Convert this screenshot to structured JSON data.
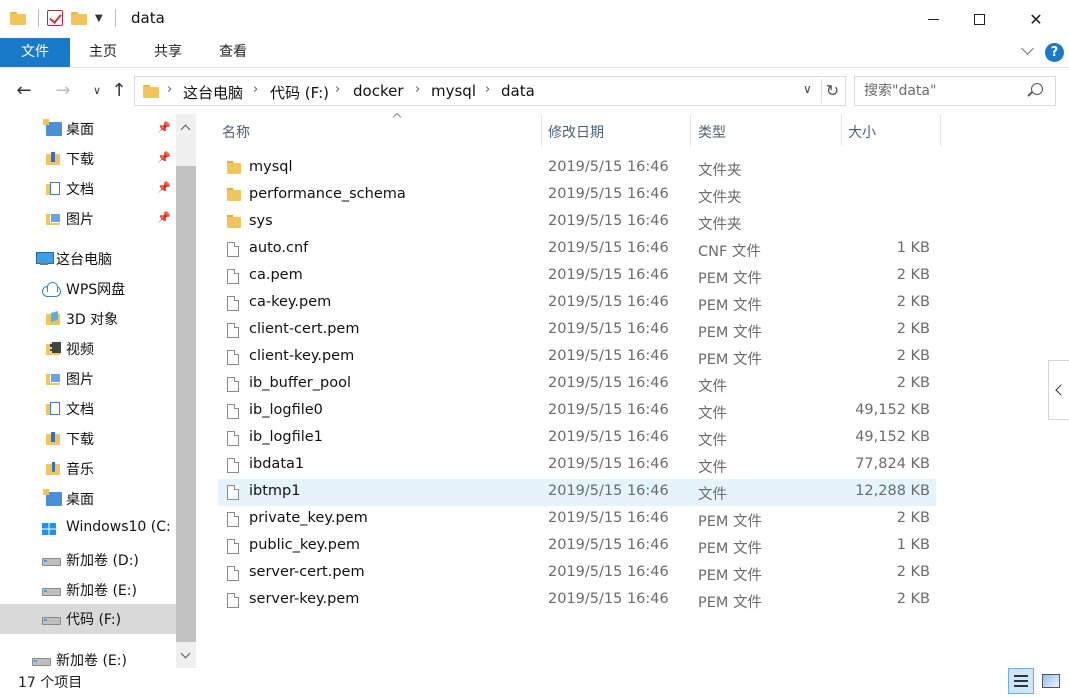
{
  "window": {
    "title": "data"
  },
  "ribbon": {
    "tabs": [
      "文件",
      "主页",
      "共享",
      "查看"
    ]
  },
  "address": {
    "crumbs": [
      "这台电脑",
      "代码 (F:)",
      "docker",
      "mysql",
      "data"
    ],
    "search_placeholder": "搜索\"data\""
  },
  "nav_pane": {
    "items": [
      {
        "label": "桌面",
        "icon": "desktop-icon",
        "pinned": true
      },
      {
        "label": "下载",
        "icon": "downloads-icon",
        "pinned": true
      },
      {
        "label": "文档",
        "icon": "documents-icon",
        "pinned": true
      },
      {
        "label": "图片",
        "icon": "pictures-icon",
        "pinned": true
      },
      {
        "label": "这台电脑",
        "icon": "this-pc-icon"
      },
      {
        "label": "WPS网盘",
        "icon": "wps-cloud-icon"
      },
      {
        "label": "3D 对象",
        "icon": "3d-objects-icon"
      },
      {
        "label": "视频",
        "icon": "videos-icon"
      },
      {
        "label": "图片",
        "icon": "pictures-icon"
      },
      {
        "label": "文档",
        "icon": "documents-icon"
      },
      {
        "label": "下载",
        "icon": "downloads-icon"
      },
      {
        "label": "音乐",
        "icon": "music-icon"
      },
      {
        "label": "桌面",
        "icon": "desktop-icon"
      },
      {
        "label": "Windows10 (C:",
        "icon": "windows-drive-icon"
      },
      {
        "label": "新加卷 (D:)",
        "icon": "drive-icon"
      },
      {
        "label": "新加卷 (E:)",
        "icon": "drive-icon"
      },
      {
        "label": "代码 (F:)",
        "icon": "drive-icon",
        "selected": true
      },
      {
        "label": "新加卷 (E:)",
        "icon": "drive-icon"
      }
    ]
  },
  "columns": {
    "name": "名称",
    "date": "修改日期",
    "type": "类型",
    "size": "大小"
  },
  "files": [
    {
      "name": "mysql",
      "date": "2019/5/15 16:46",
      "type": "文件夹",
      "size": "",
      "kind": "folder"
    },
    {
      "name": "performance_schema",
      "date": "2019/5/15 16:46",
      "type": "文件夹",
      "size": "",
      "kind": "folder"
    },
    {
      "name": "sys",
      "date": "2019/5/15 16:46",
      "type": "文件夹",
      "size": "",
      "kind": "folder"
    },
    {
      "name": "auto.cnf",
      "date": "2019/5/15 16:46",
      "type": "CNF 文件",
      "size": "1 KB",
      "kind": "file"
    },
    {
      "name": "ca.pem",
      "date": "2019/5/15 16:46",
      "type": "PEM 文件",
      "size": "2 KB",
      "kind": "file"
    },
    {
      "name": "ca-key.pem",
      "date": "2019/5/15 16:46",
      "type": "PEM 文件",
      "size": "2 KB",
      "kind": "file"
    },
    {
      "name": "client-cert.pem",
      "date": "2019/5/15 16:46",
      "type": "PEM 文件",
      "size": "2 KB",
      "kind": "file"
    },
    {
      "name": "client-key.pem",
      "date": "2019/5/15 16:46",
      "type": "PEM 文件",
      "size": "2 KB",
      "kind": "file"
    },
    {
      "name": "ib_buffer_pool",
      "date": "2019/5/15 16:46",
      "type": "文件",
      "size": "2 KB",
      "kind": "file"
    },
    {
      "name": "ib_logfile0",
      "date": "2019/5/15 16:46",
      "type": "文件",
      "size": "49,152 KB",
      "kind": "file"
    },
    {
      "name": "ib_logfile1",
      "date": "2019/5/15 16:46",
      "type": "文件",
      "size": "49,152 KB",
      "kind": "file"
    },
    {
      "name": "ibdata1",
      "date": "2019/5/15 16:46",
      "type": "文件",
      "size": "77,824 KB",
      "kind": "file"
    },
    {
      "name": "ibtmp1",
      "date": "2019/5/15 16:46",
      "type": "文件",
      "size": "12,288 KB",
      "kind": "file",
      "highlight": true
    },
    {
      "name": "private_key.pem",
      "date": "2019/5/15 16:46",
      "type": "PEM 文件",
      "size": "2 KB",
      "kind": "file"
    },
    {
      "name": "public_key.pem",
      "date": "2019/5/15 16:46",
      "type": "PEM 文件",
      "size": "1 KB",
      "kind": "file"
    },
    {
      "name": "server-cert.pem",
      "date": "2019/5/15 16:46",
      "type": "PEM 文件",
      "size": "2 KB",
      "kind": "file"
    },
    {
      "name": "server-key.pem",
      "date": "2019/5/15 16:46",
      "type": "PEM 文件",
      "size": "2 KB",
      "kind": "file"
    }
  ],
  "status": {
    "item_count": "17 个项目"
  },
  "colors": {
    "accent": "#1979ca",
    "hover_row": "#e5f3fb",
    "header_text": "#4c607a"
  }
}
